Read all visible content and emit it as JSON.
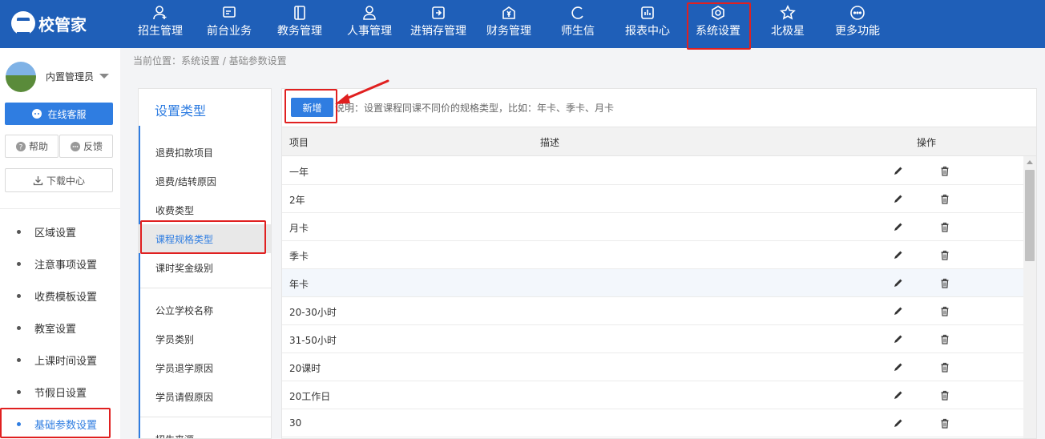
{
  "brand": {
    "name": "校管家"
  },
  "nav": {
    "items": [
      {
        "label": "招生管理",
        "icon": "user-add-icon"
      },
      {
        "label": "前台业务",
        "icon": "monitor-icon"
      },
      {
        "label": "教务管理",
        "icon": "book-icon"
      },
      {
        "label": "人事管理",
        "icon": "person-icon"
      },
      {
        "label": "进销存管理",
        "icon": "inventory-icon"
      },
      {
        "label": "财务管理",
        "icon": "yen-icon"
      },
      {
        "label": "师生信",
        "icon": "chat-icon"
      },
      {
        "label": "报表中心",
        "icon": "chart-icon"
      },
      {
        "label": "系统设置",
        "icon": "gear-icon"
      },
      {
        "label": "北极星",
        "icon": "star-icon"
      },
      {
        "label": "更多功能",
        "icon": "more-icon"
      }
    ],
    "active": "系统设置"
  },
  "user": {
    "name": "内置管理员"
  },
  "sidebar": {
    "service_label": "在线客服",
    "help_label": "帮助",
    "feedback_label": "反馈",
    "download_label": "下载中心",
    "items": [
      {
        "label": "区域设置"
      },
      {
        "label": "注意事项设置"
      },
      {
        "label": "收费模板设置"
      },
      {
        "label": "教室设置"
      },
      {
        "label": "上课时间设置"
      },
      {
        "label": "节假日设置"
      },
      {
        "label": "基础参数设置"
      }
    ],
    "active": "基础参数设置"
  },
  "breadcrumb": "当前位置：系统设置 / 基础参数设置",
  "type_panel": {
    "title": "设置类型",
    "group1": [
      {
        "label": "退费扣款项目"
      },
      {
        "label": "退费/结转原因"
      },
      {
        "label": "收费类型"
      },
      {
        "label": "课程规格类型"
      },
      {
        "label": "课时奖金级别"
      }
    ],
    "group2": [
      {
        "label": "公立学校名称"
      },
      {
        "label": "学员类别"
      },
      {
        "label": "学员退学原因"
      },
      {
        "label": "学员请假原因"
      }
    ],
    "group3": [
      {
        "label": "招生来源"
      }
    ],
    "active": "课程规格类型"
  },
  "main": {
    "add_label": "新增",
    "description": "说明：设置课程同课不同价的规格类型，比如：年卡、季卡、月卡",
    "columns": {
      "item": "项目",
      "desc": "描述",
      "ops": "操作"
    },
    "rows": [
      {
        "name": "一年"
      },
      {
        "name": "2年"
      },
      {
        "name": "月卡"
      },
      {
        "name": "季卡"
      },
      {
        "name": "年卡"
      },
      {
        "name": "20-30小时"
      },
      {
        "name": "31-50小时"
      },
      {
        "name": "20课时"
      },
      {
        "name": "20工作日"
      },
      {
        "name": "30"
      }
    ],
    "highlighted_row": "年卡"
  },
  "colors": {
    "nav_bg": "#1f5fb8",
    "accent": "#2f7de1",
    "highlight_box": "#e02020"
  }
}
